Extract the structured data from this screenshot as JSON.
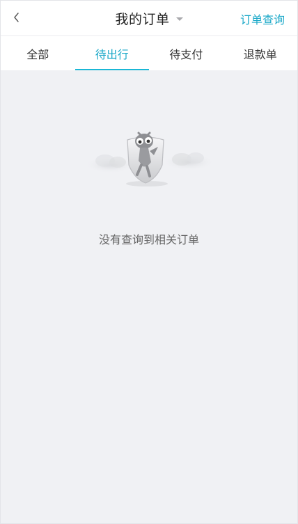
{
  "header": {
    "title": "我的订单",
    "order_query_label": "订单查询",
    "back_icon": "chevron-left-icon",
    "dropdown_icon": "caret-down-icon"
  },
  "tabs": [
    {
      "label": "全部",
      "active": false
    },
    {
      "label": "待出行",
      "active": true
    },
    {
      "label": "待支付",
      "active": false
    },
    {
      "label": "退款单",
      "active": false
    }
  ],
  "empty_state": {
    "message": "没有查询到相关订单",
    "illustration": "shield-mascot-icon"
  },
  "colors": {
    "accent": "#1aa8c8",
    "background": "#f0f1f4",
    "header_bg": "#ffffff"
  }
}
